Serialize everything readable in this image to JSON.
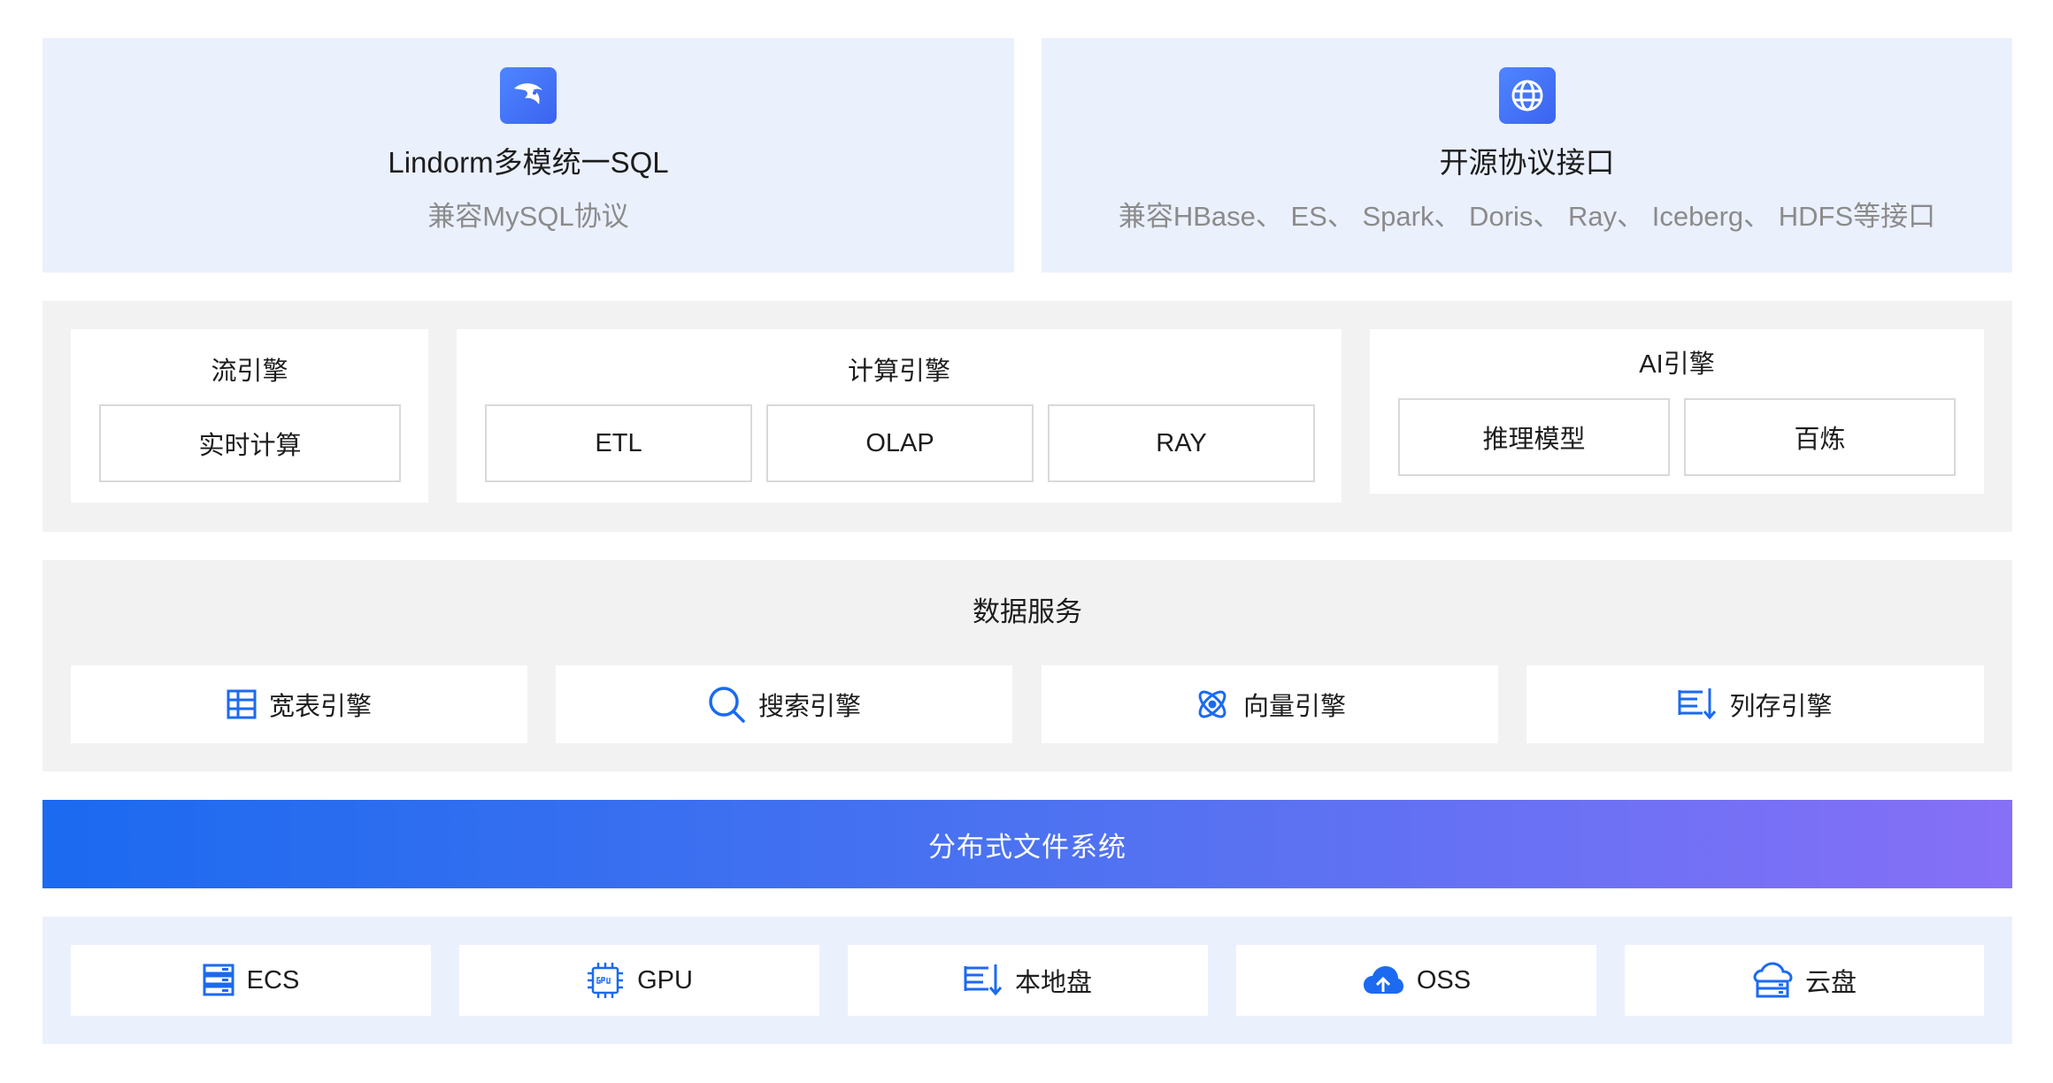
{
  "interfaces": [
    {
      "title": "Lindorm多模统一SQL",
      "subtitle": "兼容MySQL协议",
      "icon": "eagle-icon"
    },
    {
      "title": "开源协议接口",
      "subtitle": "兼容HBase、 ES、 Spark、 Doris、 Ray、 Iceberg、 HDFS等接口",
      "icon": "globe-icon"
    }
  ],
  "engines": {
    "stream": {
      "title": "流引擎",
      "items": [
        "实时计算"
      ]
    },
    "compute": {
      "title": "计算引擎",
      "items": [
        "ETL",
        "OLAP",
        "RAY"
      ]
    },
    "ai": {
      "title": "AI引擎",
      "items": [
        "推理模型",
        "百炼"
      ]
    }
  },
  "data_services": {
    "title": "数据服务",
    "items": [
      {
        "label": "宽表引擎",
        "icon": "table-grid-icon"
      },
      {
        "label": "搜索引擎",
        "icon": "search-icon"
      },
      {
        "label": "向量引擎",
        "icon": "atom-icon"
      },
      {
        "label": "列存引擎",
        "icon": "column-store-icon"
      }
    ]
  },
  "file_system": {
    "label": "分布式文件系统"
  },
  "storage": [
    {
      "label": "ECS",
      "icon": "server-stack-icon"
    },
    {
      "label": "GPU",
      "icon": "gpu-chip-icon"
    },
    {
      "label": "本地盘",
      "icon": "local-disk-icon"
    },
    {
      "label": "OSS",
      "icon": "cloud-upload-icon"
    },
    {
      "label": "云盘",
      "icon": "cloud-disk-icon"
    }
  ],
  "colors": {
    "accent_blue": "#1b6af0",
    "gradient_end": "#8670f7",
    "interface_bg": "#ebf0fd",
    "engine_bg": "#f2f2f2"
  }
}
